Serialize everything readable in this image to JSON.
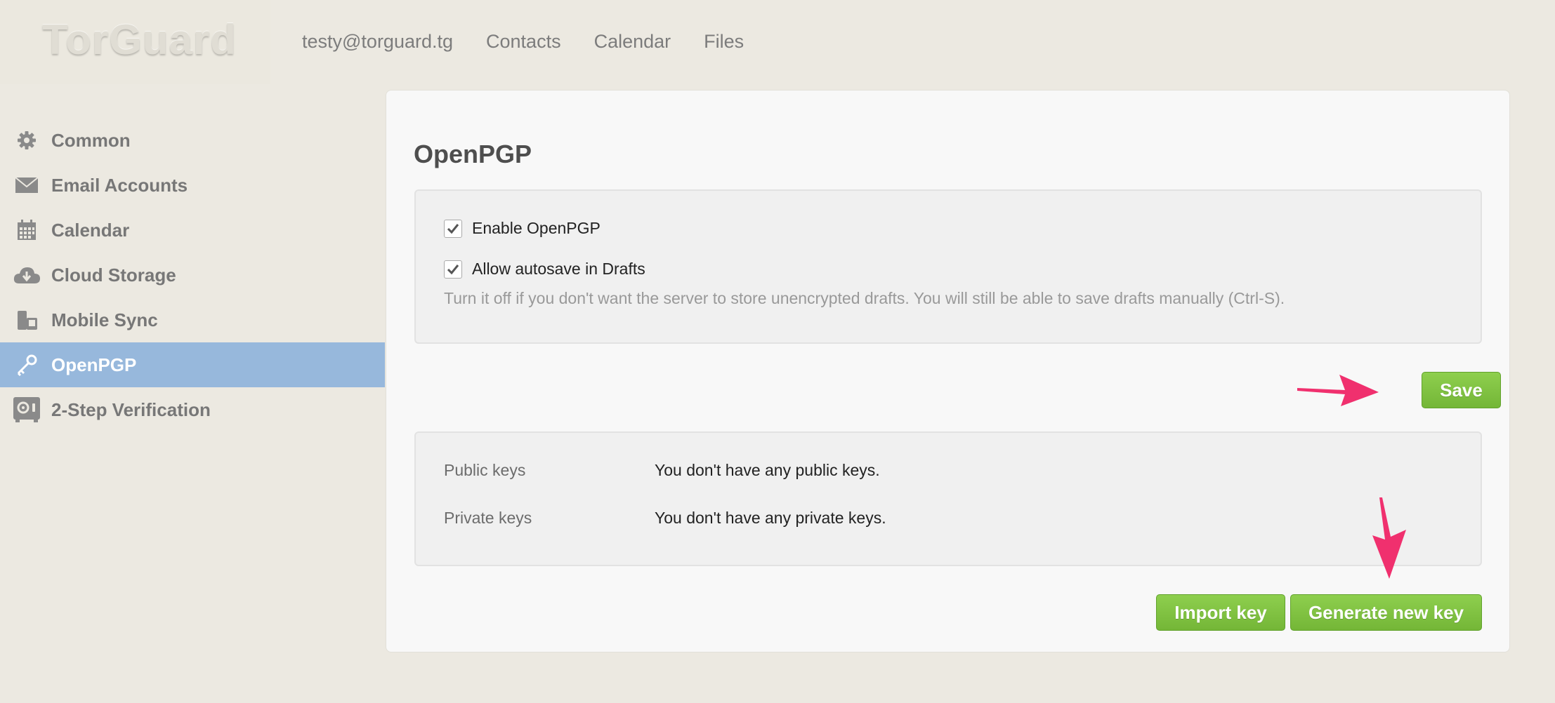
{
  "brand": {
    "logo_text": "TorGuard"
  },
  "topnav": {
    "account": "testy@torguard.tg",
    "contacts": "Contacts",
    "calendar": "Calendar",
    "files": "Files"
  },
  "sidebar": {
    "items": [
      {
        "label": "Common",
        "icon": "gear-icon"
      },
      {
        "label": "Email Accounts",
        "icon": "envelope-icon"
      },
      {
        "label": "Calendar",
        "icon": "calendar-icon"
      },
      {
        "label": "Cloud Storage",
        "icon": "cloud-icon"
      },
      {
        "label": "Mobile Sync",
        "icon": "mobile-sync-icon"
      },
      {
        "label": "OpenPGP",
        "icon": "key-icon",
        "active": true
      },
      {
        "label": "2-Step Verification",
        "icon": "safe-icon"
      }
    ]
  },
  "main": {
    "title": "OpenPGP",
    "enable_openpgp": {
      "label": "Enable OpenPGP",
      "checked": true
    },
    "autosave": {
      "label": "Allow autosave in Drafts",
      "checked": true
    },
    "autosave_hint": "Turn it off if you don't want the server to store unencrypted drafts. You will still be able to save drafts manually (Ctrl-S).",
    "save_label": "Save",
    "keys": {
      "public_label": "Public keys",
      "public_value": "You don't have any public keys.",
      "private_label": "Private keys",
      "private_value": "You don't have any private keys."
    },
    "import_label": "Import key",
    "generate_label": "Generate new key"
  },
  "colors": {
    "accent_green": "#7cbd3f",
    "active_sidebar": "#97b8dc",
    "annotation_arrow": "#f0306e"
  }
}
